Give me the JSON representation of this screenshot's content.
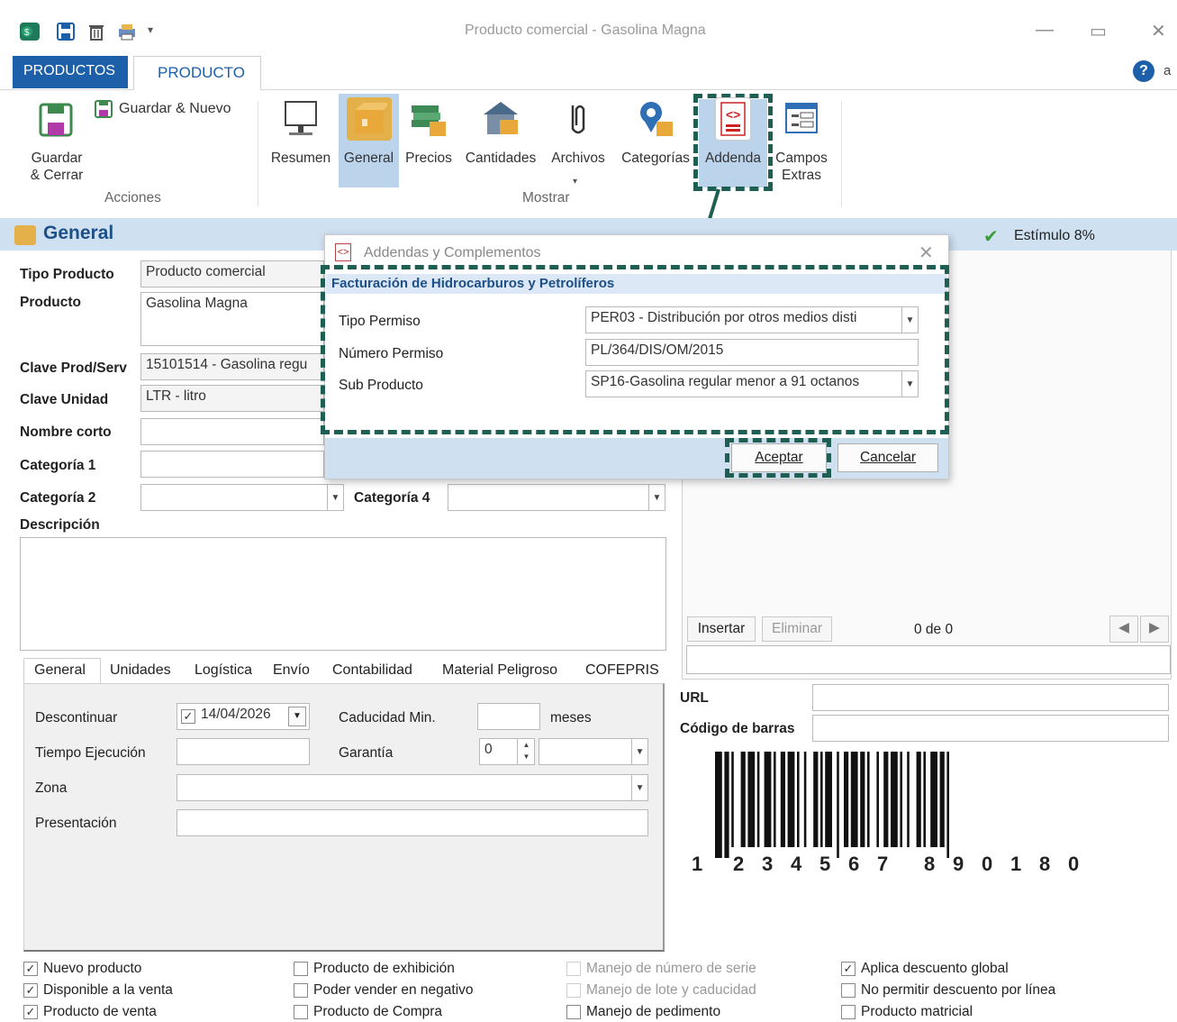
{
  "window": {
    "title": "Producto comercial - Gasolina Magna",
    "quick_icons": [
      "app-icon",
      "save-icon",
      "trash-icon",
      "printer-icon",
      "qat-dropdown-icon"
    ],
    "partial_text": "a"
  },
  "tabs": {
    "products": "PRODUCTOS",
    "product": "PRODUCTO"
  },
  "ribbon": {
    "save_close": "Guardar & Cerrar",
    "save_new": "Guardar & Nuevo",
    "acciones_group": "Acciones",
    "mostrar_group": "Mostrar",
    "buttons": [
      "Resumen",
      "General",
      "Precios",
      "Cantidades",
      "Archivos",
      "Categorías",
      "Addenda",
      "Campos Extras"
    ]
  },
  "header": {
    "title": "General",
    "estimulo": "Estímulo 8%"
  },
  "form": {
    "tipo_producto_label": "Tipo Producto",
    "tipo_producto": "Producto comercial",
    "producto_label": "Producto",
    "producto": "Gasolina Magna",
    "clave_prod_label": "Clave Prod/Serv",
    "clave_prod": "15101514 - Gasolina regu",
    "clave_unidad_label": "Clave Unidad",
    "clave_unidad": "LTR - litro",
    "nombre_corto_label": "Nombre corto",
    "nombre_corto": "",
    "categoria1_label": "Categoría 1",
    "categoria2_label": "Categoría 2",
    "categoria4_label": "Categoría 4",
    "descripcion_label": "Descripción"
  },
  "subtabs": [
    "General",
    "Unidades",
    "Logística",
    "Envío",
    "Contabilidad",
    "Material Peligroso",
    "COFEPRIS"
  ],
  "general_tab": {
    "descontinuar_label": "Descontinuar",
    "descontinuar_date": "14/04/2026",
    "caducidad_label": "Caducidad Min.",
    "meses_label": "meses",
    "tiempo_label": "Tiempo Ejecución",
    "garantia_label": "Garantía",
    "garantia_value": "0",
    "zona_label": "Zona",
    "presentacion_label": "Presentación"
  },
  "right_panel": {
    "insertar": "Insertar",
    "eliminar": "Eliminar",
    "counter": "0 de 0",
    "url_label": "URL",
    "barcode_label": "Código de barras",
    "barcode_digits": [
      "1",
      "2",
      "3",
      "4",
      "5",
      "6",
      "7",
      "8",
      "9",
      "0",
      "1",
      "8",
      "0"
    ]
  },
  "dialog": {
    "title": "Addendas y Complementos",
    "section": "Facturación de Hidrocarburos y Petrolíferos",
    "tipo_permiso_label": "Tipo Permiso",
    "tipo_permiso": "PER03 - Distribución por otros medios disti",
    "numero_permiso_label": "Número Permiso",
    "numero_permiso": "PL/364/DIS/OM/2015",
    "sub_producto_label": "Sub Producto",
    "sub_producto": "SP16-Gasolina regular menor a 91 octanos",
    "accept": "Aceptar",
    "cancel": "Cancelar"
  },
  "checkboxes": [
    {
      "label": "Nuevo producto",
      "checked": true,
      "disabled": false
    },
    {
      "label": "Disponible a la venta",
      "checked": true,
      "disabled": false
    },
    {
      "label": "Producto de venta",
      "checked": true,
      "disabled": false
    },
    {
      "label": "Producto de exhibición",
      "checked": false,
      "disabled": false
    },
    {
      "label": "Poder vender en negativo",
      "checked": false,
      "disabled": false
    },
    {
      "label": "Producto de Compra",
      "checked": false,
      "disabled": false
    },
    {
      "label": "Manejo de número de serie",
      "checked": false,
      "disabled": true
    },
    {
      "label": "Manejo de lote y caducidad",
      "checked": false,
      "disabled": true
    },
    {
      "label": "Manejo de pedimento",
      "checked": false,
      "disabled": false
    },
    {
      "label": "Aplica descuento global",
      "checked": true,
      "disabled": false
    },
    {
      "label": "No permitir descuento por línea",
      "checked": false,
      "disabled": false
    },
    {
      "label": "Producto matricial",
      "checked": false,
      "disabled": false
    }
  ],
  "colors": {
    "accent": "#1d5fa8",
    "highlight": "#1f5f53",
    "header_bar": "#cfe0f1"
  }
}
